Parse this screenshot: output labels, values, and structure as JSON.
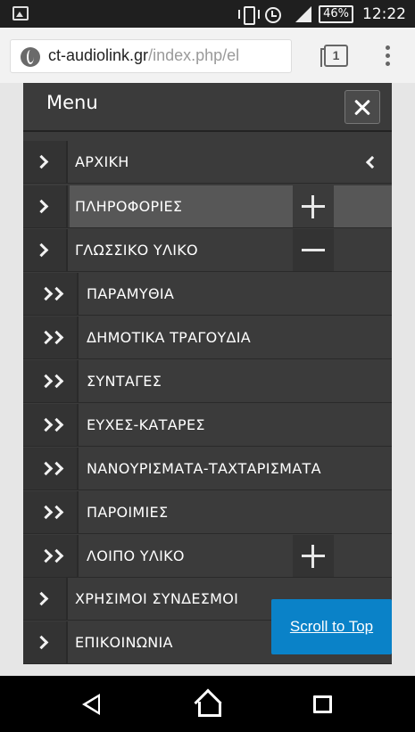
{
  "status_bar": {
    "battery": "46%",
    "time": "12:22"
  },
  "browser": {
    "url_domain": "ct-audiolink.gr",
    "url_path": "/index.php/el",
    "tab_count": "1"
  },
  "menu": {
    "title": "Menu",
    "items": [
      {
        "label": "ΑΡΧΙΚΗ"
      },
      {
        "label": "ΠΛΗΡΟΦΟΡΙΕΣ"
      },
      {
        "label": "ΓΛΩΣΣΙΚΟ ΥΛΙΚΟ"
      },
      {
        "label": "ΠΑΡΑΜΥΘΙΑ"
      },
      {
        "label": "ΔΗΜΟΤΙΚΑ ΤΡΑΓΟΥΔΙΑ"
      },
      {
        "label": "ΣΥΝΤΑΓΕΣ"
      },
      {
        "label": "ΕΥΧΕΣ-ΚΑΤΑΡΕΣ"
      },
      {
        "label": "ΝΑΝΟΥΡΙΣΜΑΤΑ-ΤΑΧΤΑΡΙΣΜΑΤΑ"
      },
      {
        "label": "ΠΑΡΟΙΜΙΕΣ"
      },
      {
        "label": "ΛΟΙΠΟ ΥΛΙΚΟ"
      },
      {
        "label": "ΧΡΗΣΙΜΟΙ ΣΥΝΔΕΣΜΟΙ"
      },
      {
        "label": "ΕΠΙΚΟΙΝΩΝΙΑ"
      }
    ]
  },
  "scroll_to_top": "Scroll to Top"
}
